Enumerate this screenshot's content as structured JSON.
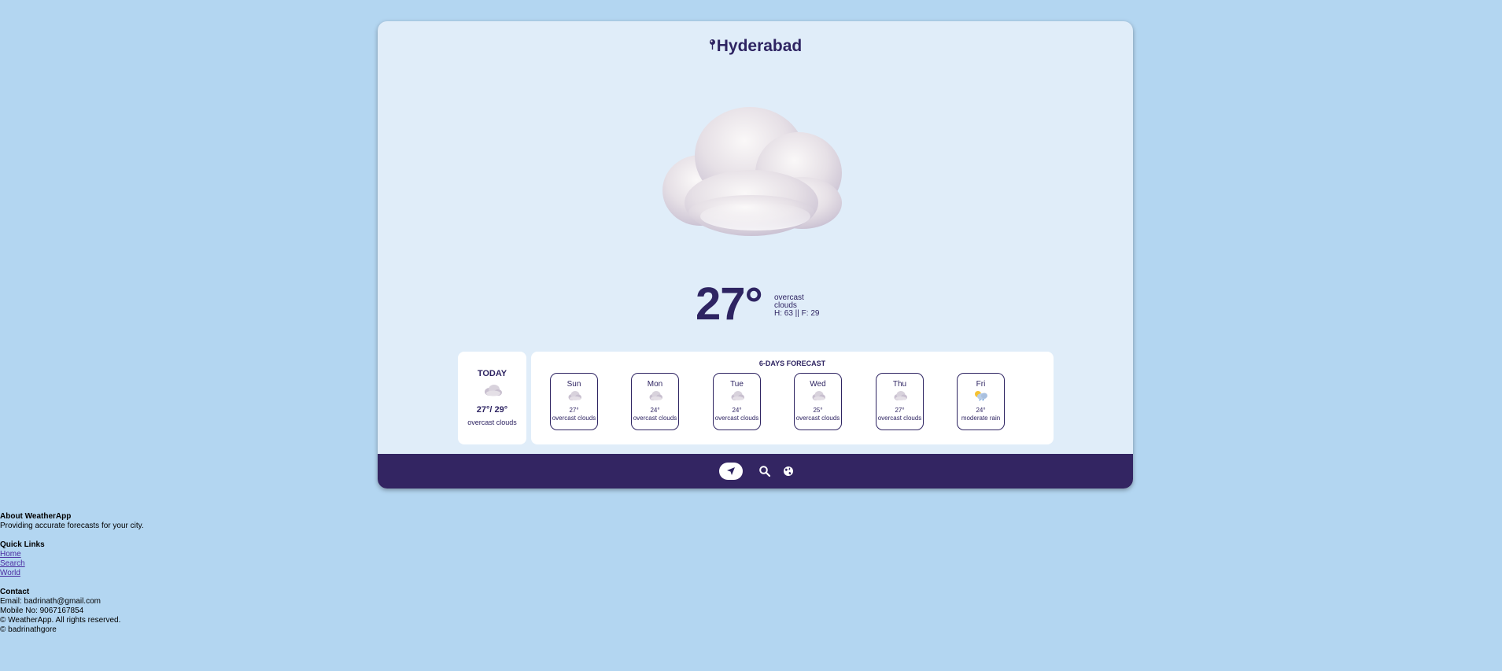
{
  "header": {
    "city": "Hyderabad"
  },
  "current": {
    "temperature": "27°",
    "condition_line1": "overcast",
    "condition_line2": "clouds",
    "high_low": "H: 63 || F: 29",
    "icon": "cloud-icon"
  },
  "today": {
    "label": "TODAY",
    "temps": "27°/ 29°",
    "description": "overcast clouds",
    "icon": "cloudy-icon"
  },
  "forecast": {
    "title": "6-DAYS FORECAST",
    "days": [
      {
        "day": "Sun",
        "temp": "27°",
        "desc": "overcast clouds",
        "icon": "cloudy-icon"
      },
      {
        "day": "Mon",
        "temp": "24°",
        "desc": "overcast clouds",
        "icon": "cloudy-icon"
      },
      {
        "day": "Tue",
        "temp": "24°",
        "desc": "overcast clouds",
        "icon": "cloudy-icon"
      },
      {
        "day": "Wed",
        "temp": "25°",
        "desc": "overcast clouds",
        "icon": "cloudy-icon"
      },
      {
        "day": "Thu",
        "temp": "27°",
        "desc": "overcast clouds",
        "icon": "cloudy-icon"
      },
      {
        "day": "Fri",
        "temp": "24°",
        "desc": "moderate rain",
        "icon": "sun-rain-icon"
      }
    ]
  },
  "nav": {
    "items": [
      {
        "icon": "location-arrow-icon",
        "active": true
      },
      {
        "icon": "search-icon",
        "active": false
      },
      {
        "icon": "globe-icon",
        "active": false
      }
    ]
  },
  "footer": {
    "about_title": "About WeatherApp",
    "about_text": "Providing accurate forecasts for your city.",
    "links_title": "Quick Links",
    "links": [
      "Home",
      "Search",
      "World"
    ],
    "contact_title": "Contact",
    "email": "Email: badrinath@gmail.com",
    "mobile": "Mobile No: 9067167854",
    "rights": "© WeatherApp. All rights reserved.",
    "author": "© badrinathgore"
  },
  "colors": {
    "page_bg": "#b3d6f1",
    "card_bg": "#e0edf9",
    "accent": "#2e2462",
    "navbar": "#332562"
  }
}
